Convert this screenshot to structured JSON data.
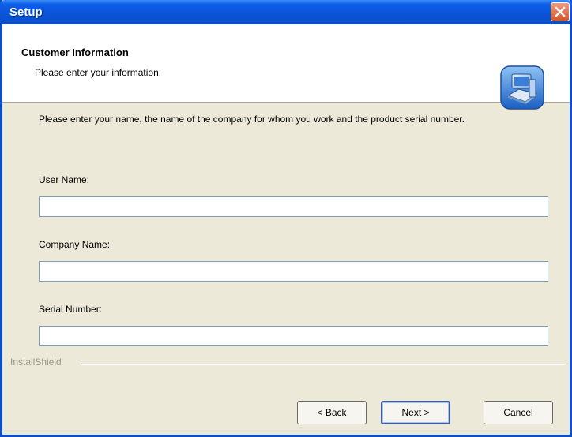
{
  "window": {
    "title": "Setup"
  },
  "header": {
    "title": "Customer Information",
    "subtitle": "Please enter your information."
  },
  "instructions": "Please enter your name, the name of the company for whom you work and the product serial number.",
  "fields": [
    {
      "label": "User Name:",
      "value": ""
    },
    {
      "label": "Company Name:",
      "value": ""
    },
    {
      "label": "Serial Number:",
      "value": ""
    }
  ],
  "footer": {
    "brand": "InstallShield"
  },
  "buttons": {
    "back": "< Back",
    "next": "Next >",
    "cancel": "Cancel"
  },
  "icons": {
    "close": "close-icon",
    "setup": "computer-setup-icon"
  },
  "colors": {
    "titlebar": "#0a53d8",
    "close": "#d8542a",
    "face": "#ece9d8"
  }
}
